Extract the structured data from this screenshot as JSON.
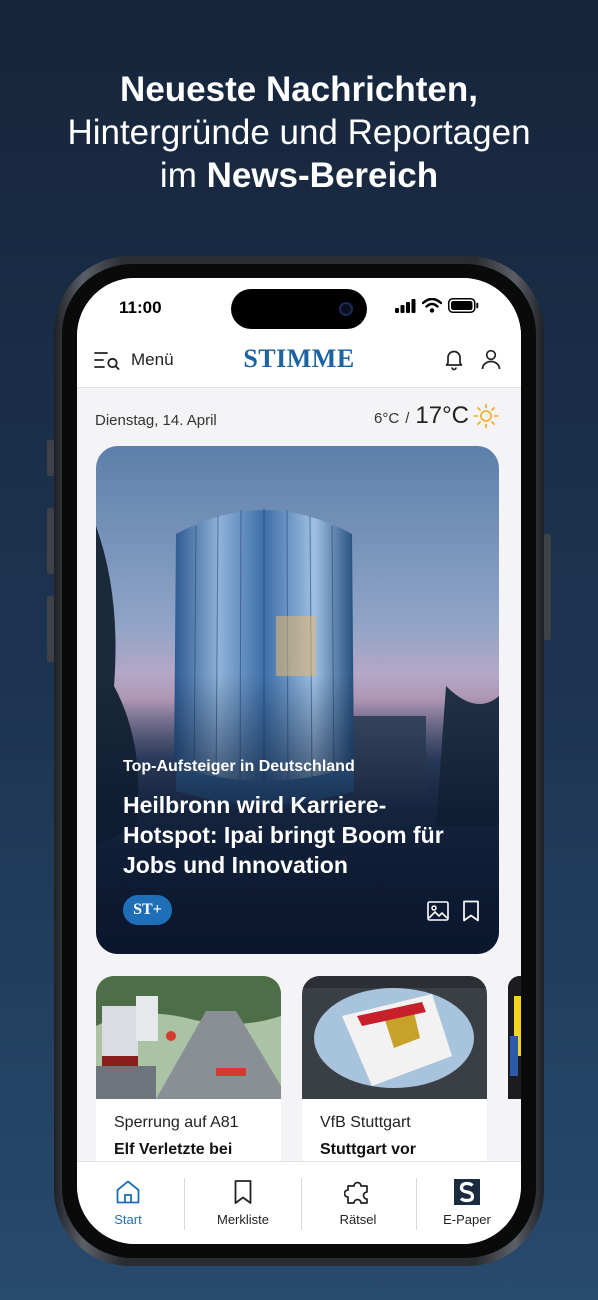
{
  "promo": {
    "line1": "Neueste Nachrichten,",
    "line2": "Hintergründe und Reportagen",
    "line3_prefix": "im",
    "line3_bold": "News-Bereich"
  },
  "status_bar": {
    "time": "11:00"
  },
  "header": {
    "menu_label": "Menü",
    "logo": "STIMME"
  },
  "date_weather": {
    "date": "Dienstag, 14. April",
    "low": "6°C",
    "separator": "/",
    "high": "17°C"
  },
  "hero": {
    "kicker": "Top-Aufsteiger in Deutschland",
    "title": "Heilbronn wird Karriere-Hotspot: Ipai bringt Boom für Jobs und Innovation",
    "badge": "ST+"
  },
  "cards": [
    {
      "kicker": "Sperrung auf A81",
      "title": "Elf Verletzte bei"
    },
    {
      "kicker": "VfB Stuttgart",
      "title": "Stuttgart vor"
    }
  ],
  "nav": [
    {
      "label": "Start",
      "icon": "home-icon",
      "active": true
    },
    {
      "label": "Merkliste",
      "icon": "bookmark-icon",
      "active": false
    },
    {
      "label": "Rätsel",
      "icon": "puzzle-icon",
      "active": false
    },
    {
      "label": "E-Paper",
      "icon": "epaper-icon",
      "active": false
    }
  ],
  "colors": {
    "brand_blue": "#1b63a3",
    "accent": "#1e6fb8",
    "background": "#1d3552"
  }
}
